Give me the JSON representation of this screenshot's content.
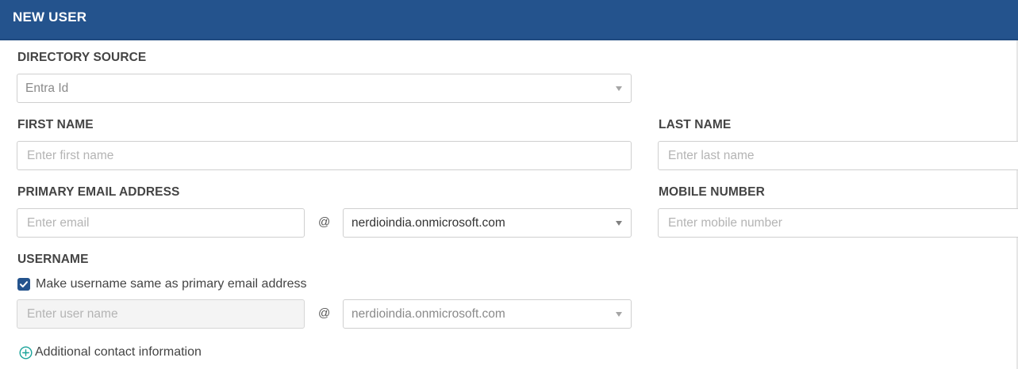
{
  "header": {
    "title": "NEW USER"
  },
  "form": {
    "directory_source": {
      "label": "DIRECTORY SOURCE",
      "value": "Entra Id"
    },
    "first_name": {
      "label": "FIRST NAME",
      "placeholder": "Enter first name",
      "value": ""
    },
    "last_name": {
      "label": "LAST NAME",
      "placeholder": "Enter last name",
      "value": ""
    },
    "primary_email": {
      "label": "PRIMARY EMAIL ADDRESS",
      "placeholder": "Enter email",
      "value": "",
      "at_symbol": "@",
      "domain": "nerdioindia.onmicrosoft.com"
    },
    "mobile_number": {
      "label": "MOBILE NUMBER",
      "placeholder": "Enter mobile number",
      "value": ""
    },
    "username": {
      "label": "USERNAME",
      "same_as_email_label": "Make username same as primary email address",
      "same_as_email_checked": true,
      "placeholder": "Enter user name",
      "value": "",
      "at_symbol": "@",
      "domain": "nerdioindia.onmicrosoft.com"
    },
    "additional_contact": {
      "label": "Additional contact information"
    }
  },
  "colors": {
    "header_bg": "#24538d",
    "accent": "#24538d",
    "add_icon": "#1aa39a"
  },
  "icons": {
    "dropdown": "chevron-down-icon",
    "checkbox": "checkmark-icon",
    "add": "plus-circle-icon"
  }
}
